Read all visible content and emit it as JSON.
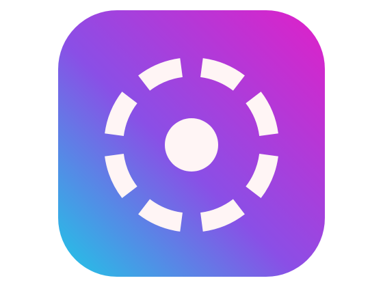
{
  "app_icon": {
    "icon": "dashed-ring-target-icon",
    "colors": {
      "gradient_top_right": "#e020c8",
      "gradient_mid": "#8a4fe6",
      "gradient_bottom_left": "#1ec8e6",
      "glyph": "#fff5f5"
    }
  }
}
